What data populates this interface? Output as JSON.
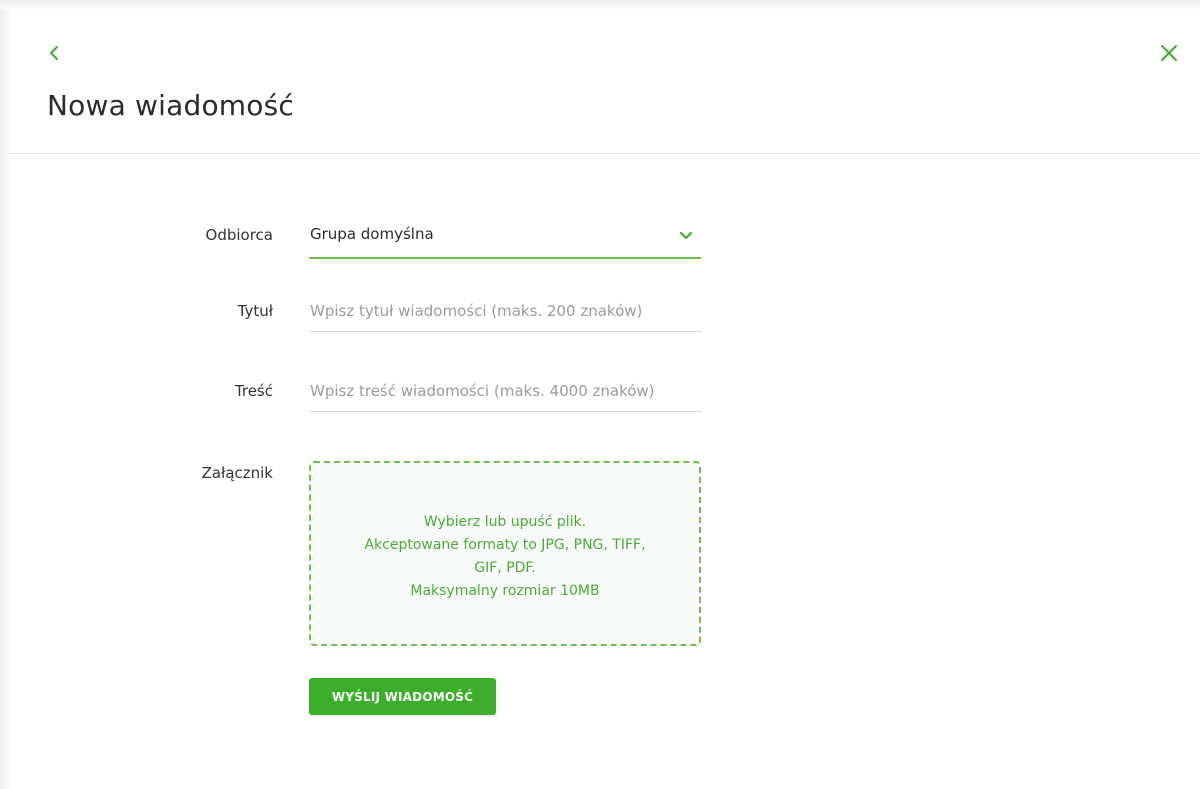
{
  "header": {
    "title": "Nowa wiadomość",
    "back_icon": "chevron-left-icon",
    "close_icon": "close-icon"
  },
  "form": {
    "recipient": {
      "label": "Odbiorca",
      "value": "Grupa domyślna",
      "icon": "chevron-down-icon"
    },
    "title": {
      "label": "Tytuł",
      "value": "",
      "placeholder": "Wpisz tytuł wiadomości (maks. 200 znaków)"
    },
    "content": {
      "label": "Treść",
      "value": "",
      "placeholder": "Wpisz treść wiadomości (maks. 4000 znaków)"
    },
    "attachment": {
      "label": "Załącznik",
      "line1": "Wybierz lub upuść plik.",
      "line2": "Akceptowane formaty to JPG, PNG, TIFF,",
      "line3": "GIF, PDF.",
      "line4": "Maksymalny rozmiar 10MB"
    },
    "submit_label": "WYŚLIJ WIADOMOŚĆ"
  },
  "colors": {
    "accent": "#3dae2b",
    "accent_light": "#6cbf4d",
    "dropzone_bg": "#f7fbf7",
    "text": "#2b2b2b",
    "placeholder": "#9a9a9a"
  }
}
